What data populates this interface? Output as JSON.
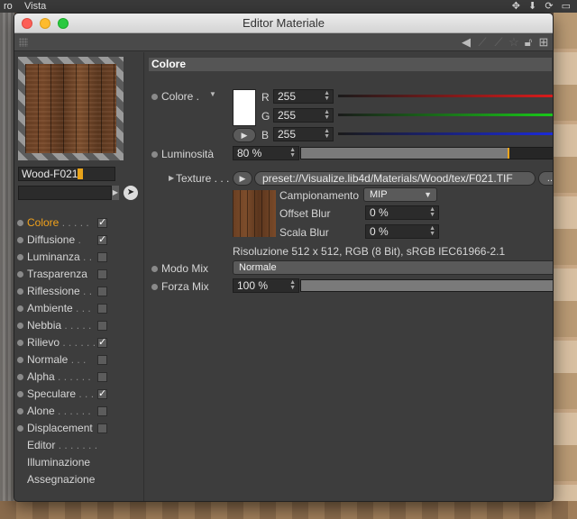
{
  "background": {
    "menubar": {
      "item_partial": "ro",
      "vista": "Vista"
    }
  },
  "window": {
    "title": "Editor Materiale"
  },
  "preview": {
    "material_name": "Wood-F021"
  },
  "channels": [
    {
      "label": "Colore",
      "dots": " . . . . .",
      "checked": true,
      "active": true
    },
    {
      "label": "Diffusione",
      "dots": " .",
      "checked": true,
      "active": false
    },
    {
      "label": "Luminanza",
      "dots": " . .",
      "checked": false,
      "active": false
    },
    {
      "label": "Trasparenza",
      "dots": "",
      "checked": false,
      "active": false
    },
    {
      "label": "Riflessione",
      "dots": " . .",
      "checked": false,
      "active": false
    },
    {
      "label": "Ambiente",
      "dots": " . . .",
      "checked": false,
      "active": false
    },
    {
      "label": "Nebbia",
      "dots": " . . . . .",
      "checked": false,
      "active": false
    },
    {
      "label": "Rilievo",
      "dots": " . . . . . .",
      "checked": true,
      "active": false
    },
    {
      "label": "Normale",
      "dots": " . . .",
      "checked": false,
      "active": false
    },
    {
      "label": "Alpha",
      "dots": " . . . . . .",
      "checked": false,
      "active": false
    },
    {
      "label": "Speculare",
      "dots": " . . .",
      "checked": true,
      "active": false
    },
    {
      "label": "Alone",
      "dots": " . . . . . .",
      "checked": false,
      "active": false
    },
    {
      "label": "Displacement",
      "dots": "",
      "checked": false,
      "active": false
    }
  ],
  "extra_items": [
    {
      "label": "Editor",
      "dots": " . . . . . . ."
    },
    {
      "label": "Illuminazione",
      "dots": ""
    },
    {
      "label": "Assegnazione",
      "dots": ""
    }
  ],
  "section": {
    "title": "Colore"
  },
  "color": {
    "label": "Colore .",
    "swatch": "#ffffff",
    "r_label": "R",
    "r_value": "255",
    "g_label": "G",
    "g_value": "255",
    "b_label": "B",
    "b_value": "255"
  },
  "luminosity": {
    "label": "Luminosità",
    "value": "80 %",
    "fraction": 0.8
  },
  "texture": {
    "label": "Texture . . .",
    "path": "preset://Visualize.lib4d/Materials/Wood/tex/F021.TIF",
    "more_button": "...",
    "sampling_label": "Campionamento",
    "sampling_value": "MIP",
    "offset_blur_label": "Offset Blur",
    "offset_blur_value": "0 %",
    "scale_blur_label": "Scala Blur",
    "scale_blur_value": "0 %",
    "info": "Risoluzione 512 x 512, RGB (8 Bit), sRGB IEC61966-2.1"
  },
  "mix_mode": {
    "label": "Modo Mix",
    "value": "Normale"
  },
  "mix_strength": {
    "label": "Forza Mix",
    "value": "100 %",
    "fraction": 1.0
  }
}
